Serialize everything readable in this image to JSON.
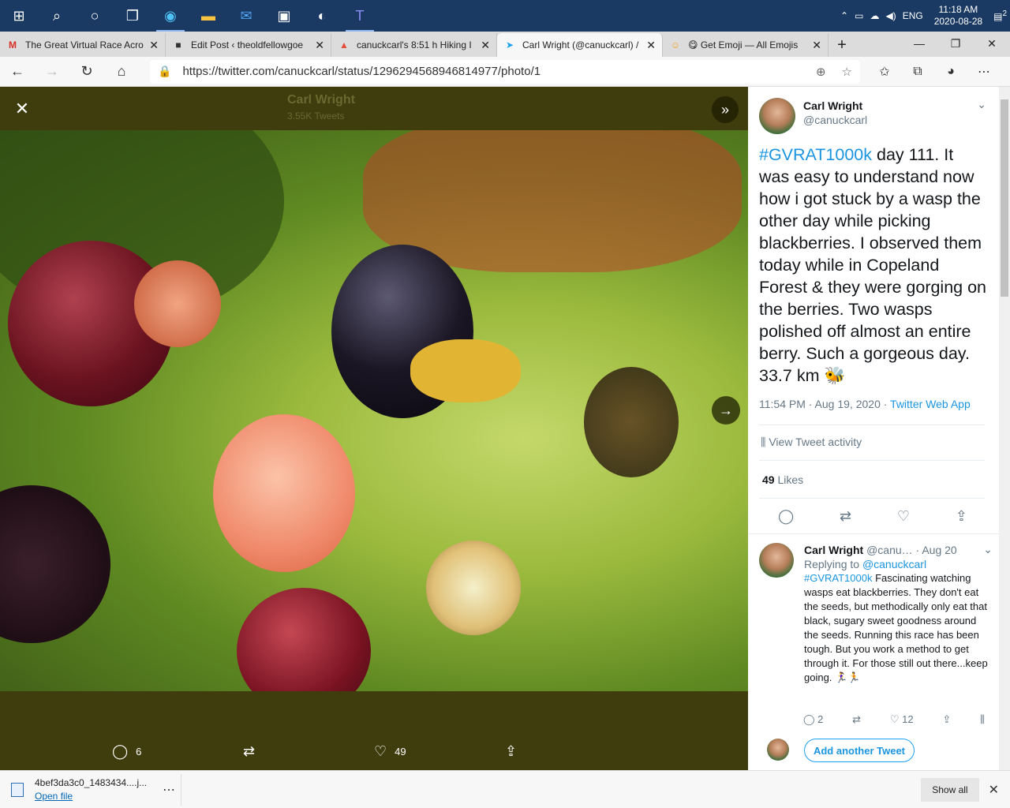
{
  "taskbar": {
    "icons": [
      "windows-start",
      "search",
      "cortana",
      "task-view",
      "edge",
      "file-explorer",
      "mail",
      "store",
      "photos",
      "teams"
    ],
    "language": "ENG",
    "time": "11:18 AM",
    "date": "2020-08-28",
    "notifications": "2"
  },
  "tabs": [
    {
      "fav": "M",
      "title": "The Great Virtual Race Acro",
      "fav_color": "#d93025"
    },
    {
      "fav": "■",
      "title": "Edit Post ‹ theoldfellowgoe",
      "fav_color": "#333333"
    },
    {
      "fav": "▲",
      "title": "canuckcarl's 8:51 h Hiking I",
      "fav_color": "#e34d3c"
    },
    {
      "fav": "➤",
      "title": "Carl Wright (@canuckcarl) /",
      "fav_color": "#1da1f2"
    },
    {
      "fav": "☺",
      "title": "😋 Get Emoji — All Emojis",
      "fav_color": "#f5a623"
    }
  ],
  "address": {
    "url": "https://twitter.com/canuckcarl/status/1296294568946814977/photo/1"
  },
  "viewer": {
    "ghost_name": "Carl Wright",
    "ghost_tweets": "3.55K Tweets",
    "reply_count": "6",
    "like_count": "49"
  },
  "tweet": {
    "name": "Carl Wright",
    "handle": "@canuckcarl",
    "hashtag": "#GVRAT1000k",
    "text": " day 111. It was easy to understand now how i got stuck by a wasp the other day while picking blackberries. I observed them today while in Copeland Forest & they were gorging on the berries. Two wasps polished off almost an entire berry. Such a gorgeous day. 33.7 km 🐝",
    "time": "11:54 PM · Aug 19, 2020 · ",
    "source": "Twitter Web App",
    "activity": "View Tweet activity",
    "likes_count": "49",
    "likes_label": " Likes"
  },
  "reply": {
    "name": "Carl Wright",
    "handle": " @canu… · Aug 20",
    "replying_label": "Replying to ",
    "replying_to": "@canuckcarl",
    "hashtag": "#GVRAT1000k",
    "text": " Fascinating watching wasps eat blackberries. They don't eat the seeds, but methodically only eat that black, sugary sweet goodness around the seeds. Running this race has been tough. But you work a method to get through it. For those still out there...keep going. 🏃‍♀️🏃",
    "reply_count": "2",
    "like_count": "12",
    "add_tweet": "Add another Tweet"
  },
  "download": {
    "file": "4bef3da3c0_1483434....j...",
    "open": "Open file",
    "show_all": "Show all"
  }
}
